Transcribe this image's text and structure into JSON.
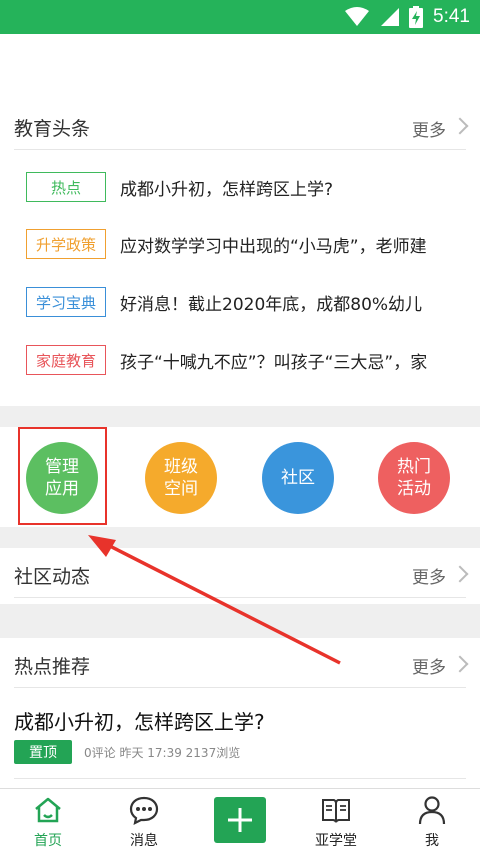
{
  "status_bar": {
    "time": "5:41",
    "icons": [
      "wifi-icon",
      "signal-icon",
      "battery-charging-icon"
    ]
  },
  "edu_headlines": {
    "title": "教育头条",
    "more": "更多",
    "items": [
      {
        "tag": "热点",
        "tag_color": "#3fba5c",
        "text": "成都小升初，怎样跨区上学?"
      },
      {
        "tag": "升学政策",
        "tag_color": "#f0a030",
        "text": "应对数学学习中出现的“小马虎”，老师建"
      },
      {
        "tag": "学习宝典",
        "tag_color": "#3a8fd8",
        "text": "好消息！截止2020年底，成都80%幼儿"
      },
      {
        "tag": "家庭教育",
        "tag_color": "#e8555a",
        "text": "孩子“十喊九不应”？叫孩子“三大忌”，家"
      }
    ]
  },
  "apps": [
    {
      "label": "管理\n应用",
      "color": "#5cbf61",
      "icon": "manage-apps-icon"
    },
    {
      "label": "班级\n空间",
      "color": "#f5aa2c",
      "icon": "class-space-icon"
    },
    {
      "label": "社区",
      "color": "#3a95dc",
      "icon": "community-icon"
    },
    {
      "label": "热门\n活动",
      "color": "#ee6060",
      "icon": "hot-activities-icon"
    }
  ],
  "community": {
    "title": "社区动态",
    "more": "更多"
  },
  "hot": {
    "title": "热点推荐",
    "more": "更多",
    "article": {
      "title": "成都小升初，怎样跨区上学?",
      "badge": "置顶",
      "meta": "0评论  昨天 17:39  2137浏览"
    }
  },
  "bottom_nav": {
    "home": "首页",
    "messages": "消息",
    "yaxuetang": "亚学堂",
    "me": "我",
    "active_color": "#23a455"
  }
}
